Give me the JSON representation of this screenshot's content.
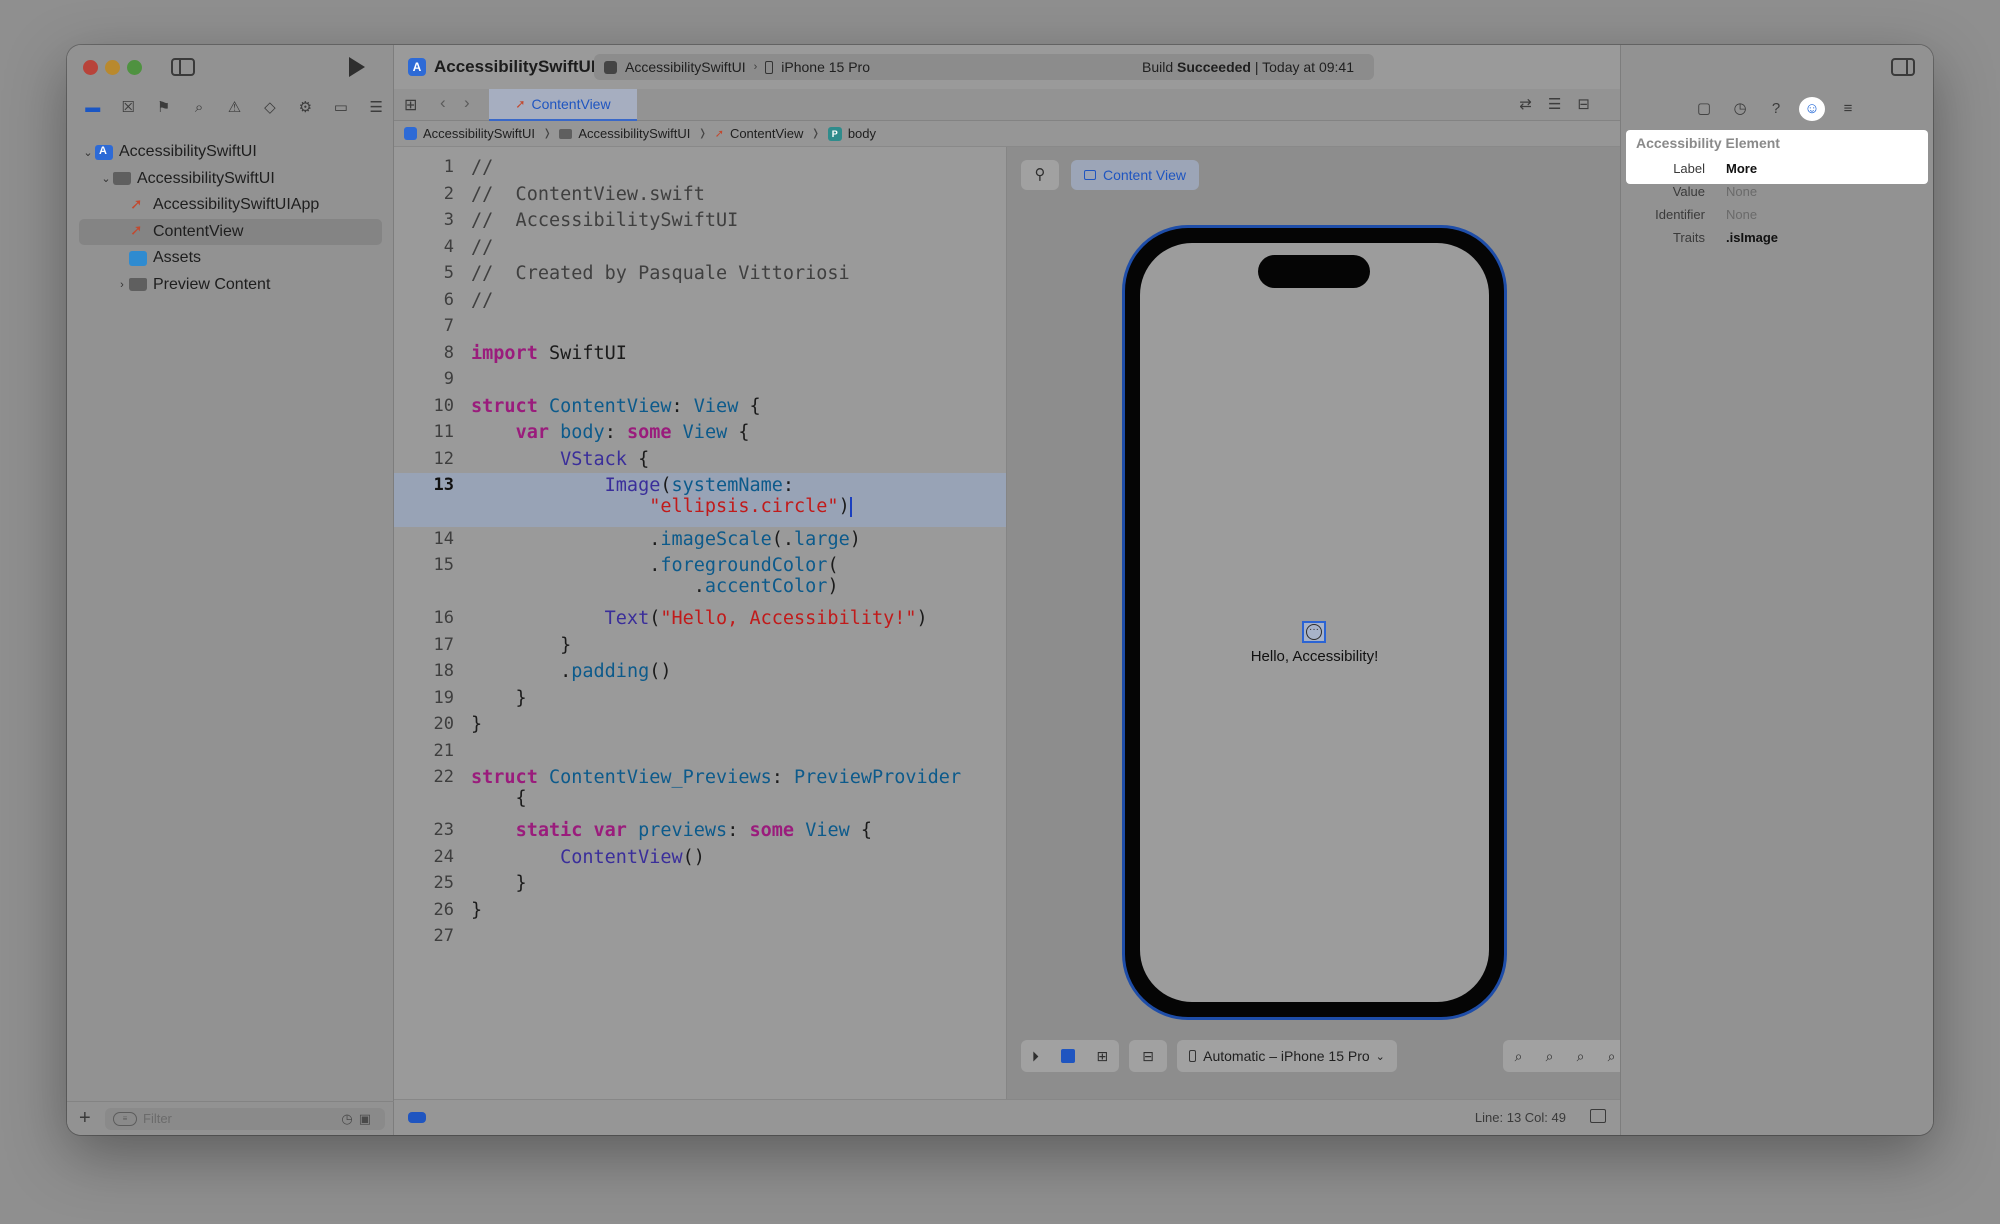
{
  "window": {
    "project_title": "AccessibilitySwiftUI",
    "scheme": {
      "app": "AccessibilitySwiftUI",
      "device": "iPhone 15 Pro",
      "status_prefix": "Build ",
      "status_strong": "Succeeded",
      "status_suffix": " | Today at 09:41"
    }
  },
  "navigator": {
    "tree": [
      {
        "label": "AccessibilitySwiftUI",
        "kind": "project"
      },
      {
        "label": "AccessibilitySwiftUI",
        "kind": "folder"
      },
      {
        "label": "AccessibilitySwiftUIApp",
        "kind": "swift"
      },
      {
        "label": "ContentView",
        "kind": "swift"
      },
      {
        "label": "Assets",
        "kind": "assets"
      },
      {
        "label": "Preview Content",
        "kind": "folder"
      }
    ],
    "filter_placeholder": "Filter"
  },
  "editor": {
    "tab": "ContentView",
    "breadcrumb": [
      "AccessibilitySwiftUI",
      "AccessibilitySwiftUI",
      "ContentView",
      "body"
    ],
    "line_numbers": [
      "1",
      "2",
      "3",
      "4",
      "5",
      "6",
      "7",
      "8",
      "9",
      "10",
      "11",
      "12",
      "13",
      "14",
      "15",
      "16",
      "17",
      "18",
      "19",
      "20",
      "21",
      "22",
      "23",
      "24",
      "25",
      "26",
      "27"
    ],
    "status": "Line: 13  Col: 49"
  },
  "canvas": {
    "chip_label": "Content View",
    "preview_text": "Hello, Accessibility!",
    "device_picker": "Automatic – iPhone 15 Pro"
  },
  "inspector": {
    "title": "Accessibility Element",
    "rows": [
      {
        "key": "Label",
        "value": "More"
      },
      {
        "key": "Value",
        "value": "None"
      },
      {
        "key": "Identifier",
        "value": "None"
      },
      {
        "key": "Traits",
        "value": ".isImage"
      }
    ]
  }
}
